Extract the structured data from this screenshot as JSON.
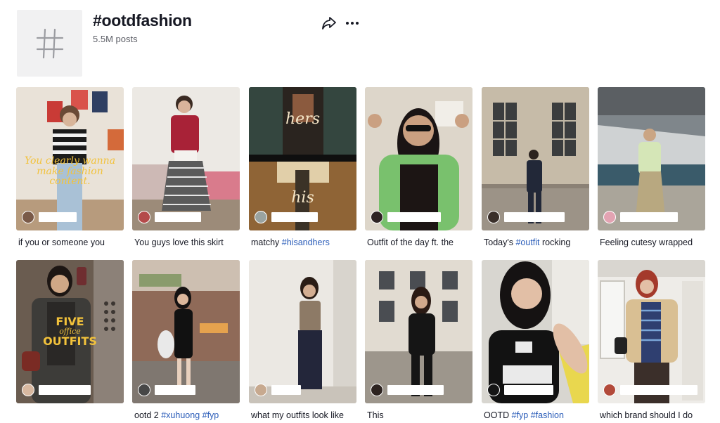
{
  "header": {
    "title": "#ootdfashion",
    "post_count": "5.5M posts",
    "icon": "hashtag-icon",
    "share_icon": "share-icon",
    "more_icon": "more-icon"
  },
  "videos": [
    {
      "caption_plain": "if you or someone you",
      "caption_tags": "",
      "overlay": "You clearly wanna make fashion content.",
      "overlay2": ""
    },
    {
      "caption_plain": "You guys love this skirt",
      "caption_tags": "",
      "overlay": "",
      "overlay2": ""
    },
    {
      "caption_plain": "matchy ",
      "caption_tags": "#hisandhers",
      "overlay": "hers",
      "overlay2": "his"
    },
    {
      "caption_plain": "Outfit of the day ft. the",
      "caption_tags": "",
      "overlay": "",
      "overlay2": ""
    },
    {
      "caption_plain": "Today's ",
      "caption_tags": "#outfit",
      "caption_after": " rocking",
      "overlay": "",
      "overlay2": ""
    },
    {
      "caption_plain": "Feeling cutesy wrapped",
      "caption_tags": "",
      "overlay": "",
      "overlay2": ""
    },
    {
      "caption_plain": "",
      "caption_tags": "",
      "overlay": "FIVE",
      "overlay_mid": "office",
      "overlay2": "OUTFITS"
    },
    {
      "caption_plain": "ootd 2 ",
      "caption_tags": "#xuhuong #fyp",
      "overlay": "",
      "overlay2": ""
    },
    {
      "caption_plain": "what my outfits look like",
      "caption_tags": "",
      "overlay": "",
      "overlay2": ""
    },
    {
      "caption_plain": "This",
      "caption_tags": "",
      "overlay": "",
      "overlay2": ""
    },
    {
      "caption_plain": "OOTD ",
      "caption_tags": "#fyp #fashion",
      "overlay": "",
      "overlay2": ""
    },
    {
      "caption_plain": "which brand should I do",
      "caption_tags": "",
      "overlay": "",
      "overlay2": ""
    }
  ],
  "colors": {
    "hashtag_link": "#2b5db9",
    "overlay_yellow": "#f2c23b"
  }
}
